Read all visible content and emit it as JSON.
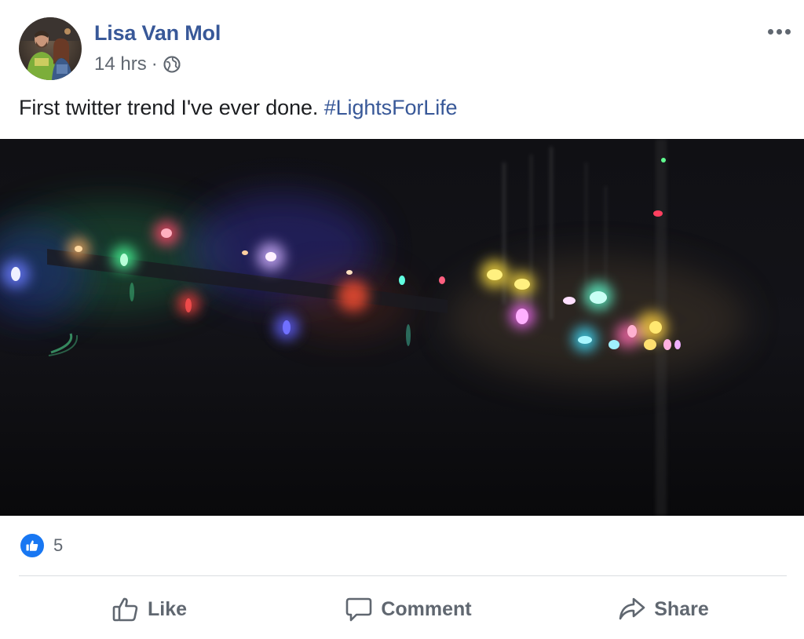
{
  "post": {
    "author": "Lisa Van Mol",
    "timestamp": "14 hrs",
    "separator": "·",
    "privacy_icon": "globe-icon",
    "message": "First twitter trend I've ever done.",
    "hashtag": "#LightsForLife",
    "menu_icon": "more-options-icon"
  },
  "reactions": {
    "icon": "like-reaction-icon",
    "count": "5"
  },
  "actions": {
    "like": "Like",
    "comment": "Comment",
    "share": "Share"
  },
  "colors": {
    "link": "#385898",
    "secondary_text": "#606770",
    "like_blue": "#1877f2",
    "divider": "#dadde1"
  }
}
